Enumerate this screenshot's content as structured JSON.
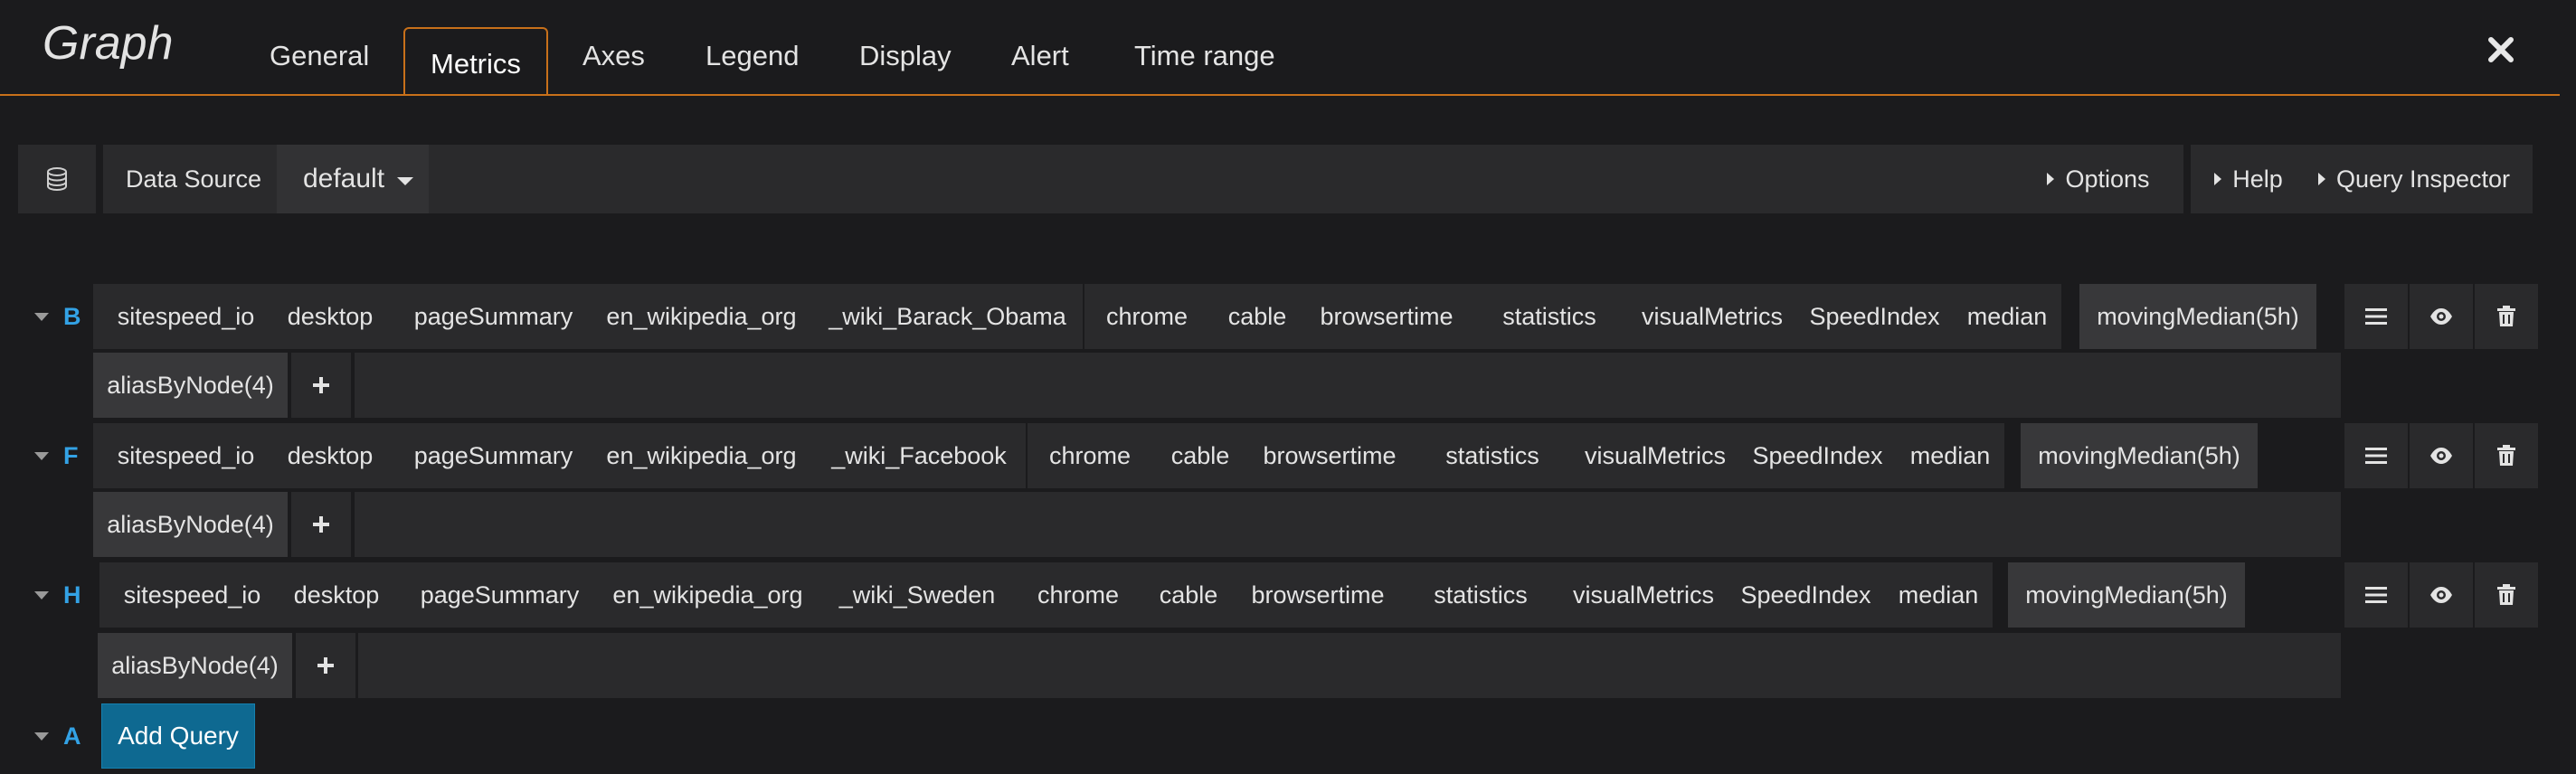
{
  "panel": {
    "title": "Graph"
  },
  "tabs": [
    {
      "label": "General"
    },
    {
      "label": "Metrics",
      "active": true
    },
    {
      "label": "Axes"
    },
    {
      "label": "Legend"
    },
    {
      "label": "Display"
    },
    {
      "label": "Alert"
    },
    {
      "label": "Time range"
    }
  ],
  "close_icon": "close-icon",
  "datasource": {
    "icon": "database-icon",
    "label": "Data Source",
    "selected": "default",
    "buttons": {
      "options": "Options",
      "help": "Help",
      "inspector": "Query Inspector"
    }
  },
  "queries": [
    {
      "letter": "B",
      "segments": [
        "sitespeed_io",
        "desktop",
        "pageSummary",
        "en_wikipedia_org",
        "_wiki_Barack_Obama",
        "chrome",
        "cable",
        "browsertime",
        "statistics",
        "visualMetrics",
        "SpeedIndex",
        "median"
      ],
      "function": "movingMedian(5h)",
      "sub_function": "aliasByNode(4)"
    },
    {
      "letter": "F",
      "segments": [
        "sitespeed_io",
        "desktop",
        "pageSummary",
        "en_wikipedia_org",
        "_wiki_Facebook",
        "chrome",
        "cable",
        "browsertime",
        "statistics",
        "visualMetrics",
        "SpeedIndex",
        "median"
      ],
      "function": "movingMedian(5h)",
      "sub_function": "aliasByNode(4)"
    },
    {
      "letter": "H",
      "segments": [
        "sitespeed_io",
        "desktop",
        "pageSummary",
        "en_wikipedia_org",
        "_wiki_Sweden",
        "chrome",
        "cable",
        "browsertime",
        "statistics",
        "visualMetrics",
        "SpeedIndex",
        "median"
      ],
      "function": "movingMedian(5h)",
      "sub_function": "aliasByNode(4)"
    }
  ],
  "add_query": {
    "letter": "A",
    "label": "Add Query"
  },
  "row_actions": [
    "menu-icon",
    "eye-icon",
    "trash-icon"
  ],
  "colors": {
    "accent": "#c8701a",
    "query_letter": "#33a2e5",
    "add_button": "#0e6991",
    "background": "#1b1b1d",
    "segment": "#2a2a2c"
  }
}
